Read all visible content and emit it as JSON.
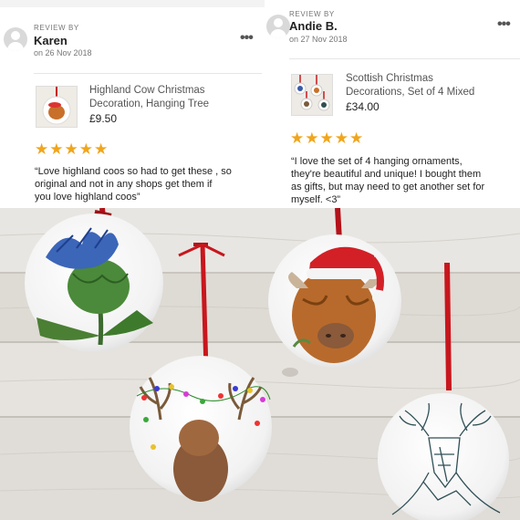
{
  "reviews": [
    {
      "review_by": "REVIEW BY",
      "name": "Karen",
      "date": "on 26 Nov 2018",
      "more_icon": "more-horizontal-icon",
      "product_title_1": "Highland Cow Christmas",
      "product_title_2": "Decoration, Hanging Tree",
      "price": "£9.50",
      "rating": 5,
      "stars": "★★★★★",
      "text_1": "“Love highland coos so had to get these , so",
      "text_2": "original and not in any shops   get them if",
      "text_3": "you love highland coos”"
    },
    {
      "review_by": "REVIEW BY",
      "name": "Andie B.",
      "date": "on 27 Nov 2018",
      "more_icon": "more-horizontal-icon",
      "product_title_1": "Scottish Christmas",
      "product_title_2": "Decorations, Set of 4 Mixed",
      "price": "£34.00",
      "rating": 5,
      "stars": "★★★★★",
      "text_1": "“I love the set of 4 hanging ornaments,",
      "text_2": "they're beautiful and unique! I bought them",
      "text_3": "as gifts, but may need to get another set for",
      "text_4": "myself. <3”"
    }
  ],
  "colors": {
    "star": "#f1a51c",
    "ribbon": "#c8161d",
    "wood": "#e3e0db"
  }
}
